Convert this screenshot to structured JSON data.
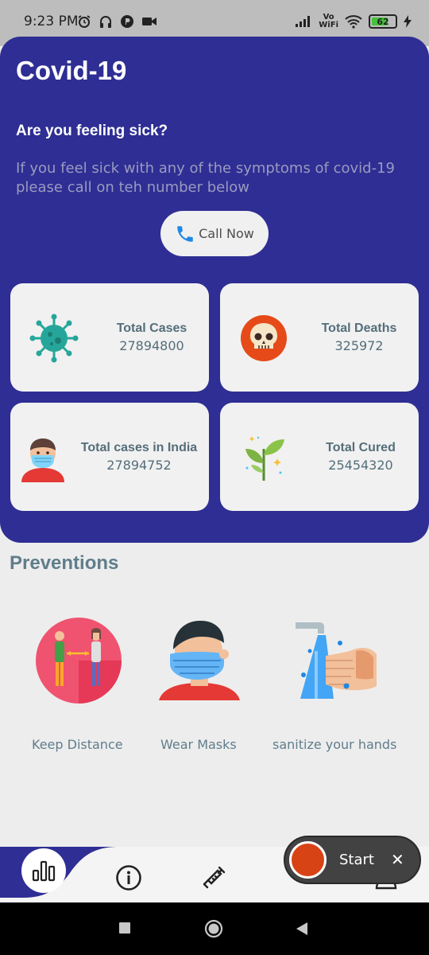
{
  "status_bar": {
    "time": "9:23 PM",
    "battery": "62",
    "vowifi_line1": "Vo",
    "vowifi_line2": "WiFi"
  },
  "header": {
    "title": "Covid-19",
    "subtitle": "Are you feeling sick?",
    "description": "If you feel sick with any of the symptoms of covid-19 please call on teh number below",
    "call_button": "Call Now",
    "background_color": "#2e2e94"
  },
  "stats": [
    {
      "label": "Total Cases",
      "value": "27894800",
      "icon": "virus-icon"
    },
    {
      "label": "Total Deaths",
      "value": "325972",
      "icon": "skull-icon"
    },
    {
      "label": "Total cases in India",
      "value": "27894752",
      "icon": "masked-person-icon"
    },
    {
      "label": "Total Cured",
      "value": "25454320",
      "icon": "plant-icon"
    }
  ],
  "preventions": {
    "title": "Preventions",
    "items": [
      {
        "label": "Keep Distance",
        "icon": "social-distance-icon"
      },
      {
        "label": "Wear Masks",
        "icon": "face-mask-icon"
      },
      {
        "label": "sanitize your hands",
        "icon": "hand-wash-icon"
      }
    ]
  },
  "bottom_nav": {
    "items": [
      "stats-icon",
      "info-icon",
      "vaccine-icon",
      "profile-icon"
    ],
    "active": "stats-icon"
  },
  "recorder": {
    "start_label": "Start",
    "close_label": "✕"
  }
}
